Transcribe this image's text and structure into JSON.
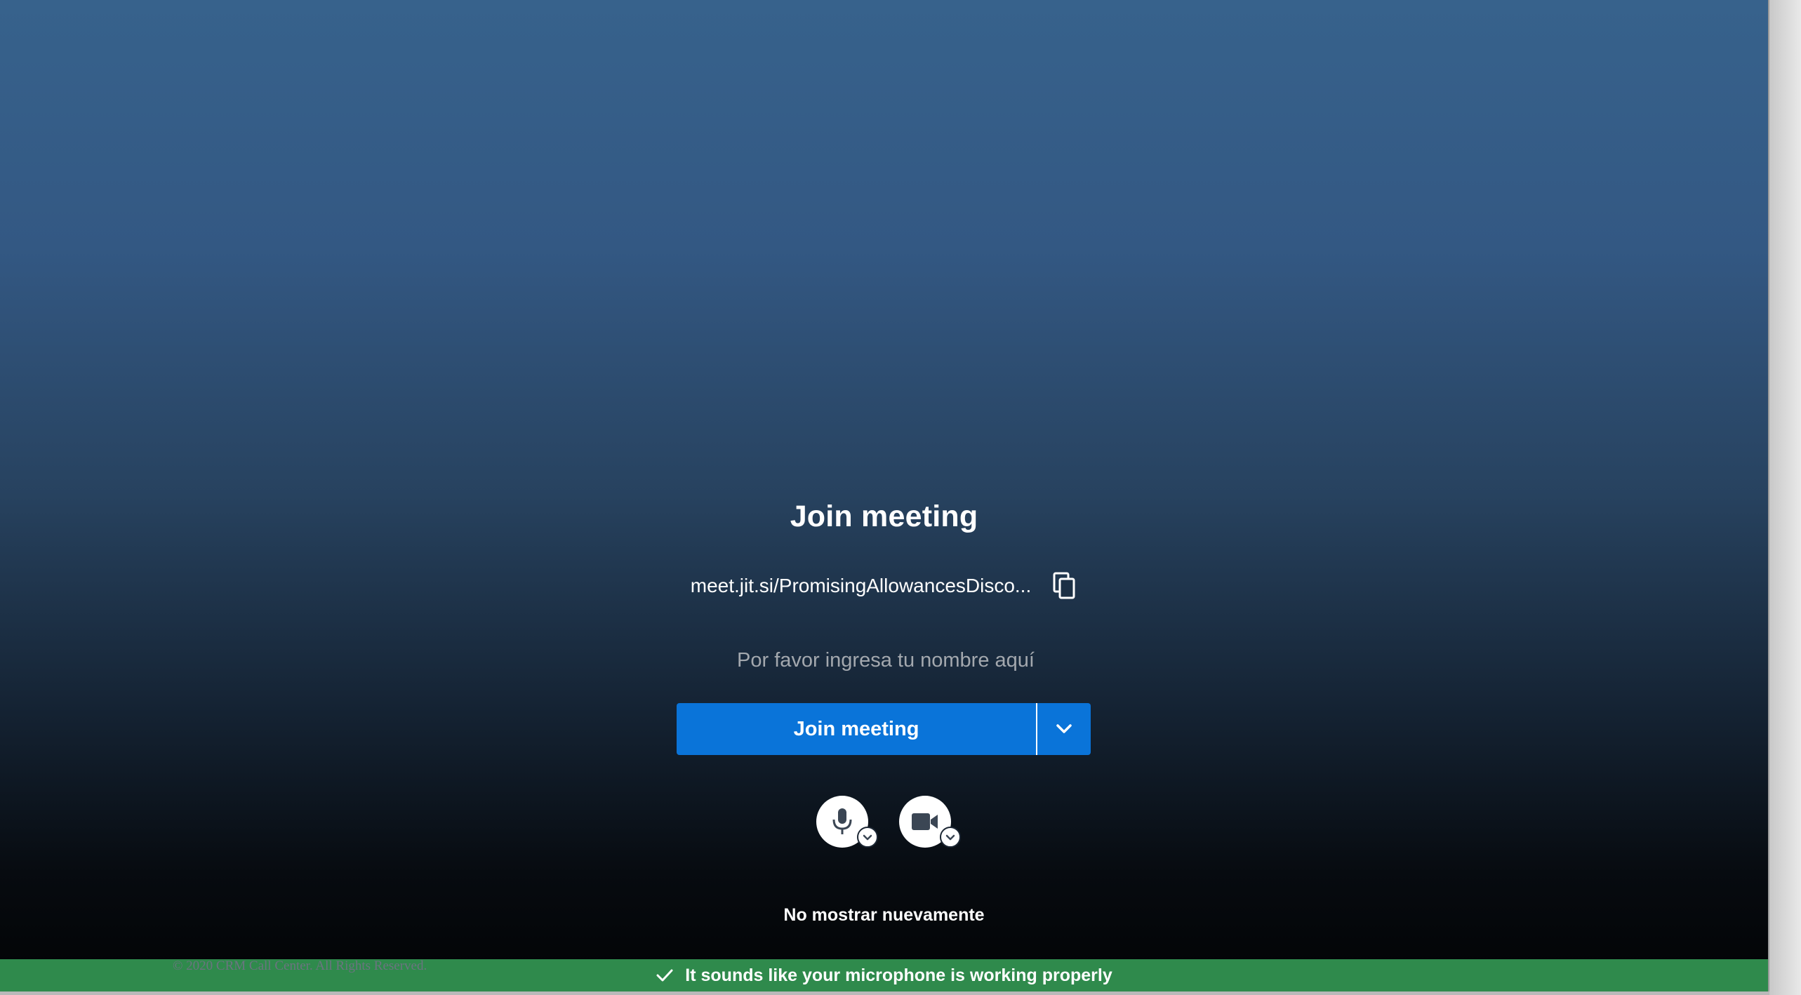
{
  "prejoin": {
    "title": "Join meeting",
    "meeting_url": "meet.jit.si/PromisingAllowancesDisco...",
    "name_placeholder": "Por favor ingresa tu nombre aquí",
    "join_label": "Join meeting",
    "dont_show_again": "No mostrar nuevamente"
  },
  "devices": {
    "microphone_icon": "microphone-icon",
    "camera_icon": "video-camera-icon"
  },
  "footer": {
    "copyright": "© 2020 CRM Call Center. All Rights Reserved."
  },
  "notification": {
    "message": "It sounds like your microphone is working properly",
    "icon": "checkmark-icon",
    "color": "#2f8a4c"
  },
  "colors": {
    "accent": "#0a74d9",
    "background_top": "#37628c",
    "background_bottom": "#020304"
  }
}
